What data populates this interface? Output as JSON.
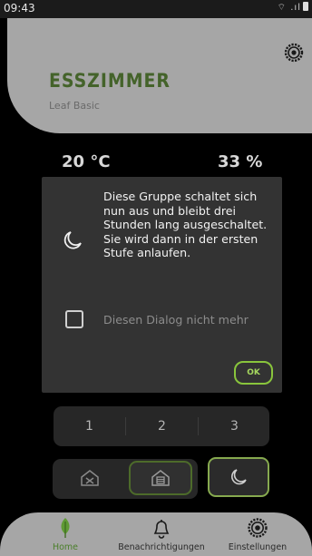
{
  "status": {
    "time": "09:43",
    "icons_text": "⌔ .ıl"
  },
  "header": {
    "title": "ESSZIMMER",
    "subtitle": "Leaf Basic"
  },
  "readings": {
    "temperature": "20 °C",
    "humidity": "33 %"
  },
  "dialog": {
    "message": "Diese Gruppe schaltet sich nun aus und bleibt drei Stunden lang ausgeschaltet. Sie wird dann in der ersten Stufe anlaufen.",
    "checkbox_label": "Diesen Dialog nicht mehr",
    "checkbox_checked": false,
    "ok_label": "OK"
  },
  "levels": [
    "1",
    "2",
    "3"
  ],
  "modes": [
    {
      "name": "mode-auto",
      "icon": "house-fan-icon",
      "active": false
    },
    {
      "name": "mode-manual",
      "icon": "house-vent-icon",
      "active": true
    }
  ],
  "night_mode": {
    "icon": "moon-icon",
    "active": true
  },
  "nav": [
    {
      "label": "Home",
      "icon": "leaf-icon",
      "active": true
    },
    {
      "label": "Benachrichtigungen",
      "icon": "bell-icon",
      "active": false
    },
    {
      "label": "Einstellungen",
      "icon": "gear-icon",
      "active": false
    }
  ],
  "colors": {
    "accent_green": "#89c53c",
    "title_green": "#44632a",
    "card_gray": "#a6a6a6",
    "dialog_bg": "#333333"
  }
}
